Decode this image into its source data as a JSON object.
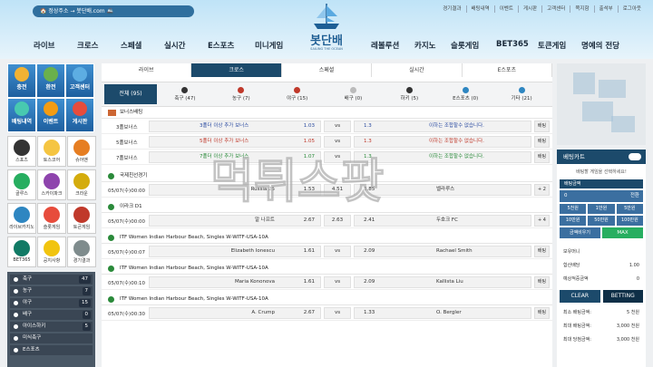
{
  "header": {
    "announce": "🏠 정상주소 → 봇단배.com 🚢",
    "top_links": [
      "경기결과",
      "배팅내역",
      "이벤트",
      "게시판",
      "고객센터",
      "쪽지함",
      "출석부",
      "로그아웃"
    ],
    "logo_name": "봇단배",
    "logo_sub": "SAILING THE OCEAN",
    "nav": [
      "라이브",
      "크로스",
      "스페셜",
      "실시간",
      "E스포츠",
      "미니게임",
      "레볼루션",
      "카지노",
      "슬롯게임",
      "BET365",
      "토큰게임",
      "명예의 전당"
    ]
  },
  "quick": [
    {
      "label": "충전",
      "color": "#f2b233"
    },
    {
      "label": "환전",
      "color": "#6ab04c"
    },
    {
      "label": "고객센터",
      "color": "#5dade2"
    },
    {
      "label": "배팅내역",
      "color": "#48c9b0"
    },
    {
      "label": "이벤트",
      "color": "#f39c12"
    },
    {
      "label": "게시판",
      "color": "#e74c3c"
    }
  ],
  "games": [
    {
      "label": "스포츠",
      "color": "#333"
    },
    {
      "label": "토스코어",
      "color": "#f5c542"
    },
    {
      "label": "슈어맨",
      "color": "#e67e22"
    },
    {
      "label": "골루스",
      "color": "#27ae60"
    },
    {
      "label": "스카이파크",
      "color": "#8e44ad"
    },
    {
      "label": "크라운",
      "color": "#d4ac0d"
    },
    {
      "label": "라이브카지노",
      "color": "#2e86c1"
    },
    {
      "label": "슬롯게임",
      "color": "#e74c3c"
    },
    {
      "label": "토큰게임",
      "color": "#c0392b"
    },
    {
      "label": "BET365",
      "color": "#117a65"
    },
    {
      "label": "공지사항",
      "color": "#f1c40f"
    },
    {
      "label": "경기결과",
      "color": "#7f8c8d"
    }
  ],
  "sports": [
    {
      "name": "축구",
      "count": "47"
    },
    {
      "name": "농구",
      "count": "7"
    },
    {
      "name": "야구",
      "count": "15"
    },
    {
      "name": "배구",
      "count": "0"
    },
    {
      "name": "아이스하키",
      "count": "5"
    },
    {
      "name": "미식축구",
      "count": ""
    },
    {
      "name": "E스포츠",
      "count": ""
    }
  ],
  "tabs": [
    "라이브",
    "크로스",
    "스페셜",
    "실시간",
    "E스포츠"
  ],
  "filters": {
    "all": "전체 (95)",
    "items": [
      "축구 (47)",
      "농구 (7)",
      "야구 (15)",
      "배구 (0)",
      "하키 (5)",
      "E스포츠 (0)",
      "기타 (21)"
    ]
  },
  "sections": [
    {
      "title": "보너스배팅",
      "rows": [
        {
          "left": "3폴보너스",
          "mid": "3폴더 이상 추가 보너스",
          "odds": "1.03",
          "vs": "vs",
          "r": "1.3",
          "right": "이하는 조합할수 없습니다.",
          "bet": "배팅",
          "cls": "blue"
        },
        {
          "left": "5폴보너스",
          "mid": "5폴더 이상 추가 보너스",
          "odds": "1.05",
          "vs": "vs",
          "r": "1.3",
          "right": "이하는 조합할수 없습니다.",
          "bet": "배팅",
          "cls": "red"
        },
        {
          "left": "7폴보너스",
          "mid": "7폴더 이상 추가 보너스",
          "odds": "1.07",
          "vs": "vs",
          "r": "1.3",
          "right": "이하는 조합할수 없습니다.",
          "bet": "배팅",
          "cls": "green"
        }
      ]
    },
    {
      "title": "국제친선경기",
      "rows": [
        {
          "time": "05/07(수)00:00",
          "home": "Russia 25",
          "h": "1.53",
          "d": "4.51",
          "a": "3.85",
          "away": "벨라루스",
          "bet": "+ 2"
        }
      ]
    },
    {
      "title": "이라크 D1",
      "rows": [
        {
          "time": "05/07(수)00:00",
          "home": "알 나프트",
          "h": "2.67",
          "d": "2.63",
          "a": "2.41",
          "away": "두호크 FC",
          "bet": "+ 4"
        }
      ]
    },
    {
      "title": "ITF Women Indian Harbour Beach, Singles W-WITF-USA-10A",
      "rows": [
        {
          "time": "05/07(수)00:07",
          "home": "Elizabeth Ionescu",
          "h": "1.61",
          "d": "vs",
          "a": "2.09",
          "away": "Rachael Smith",
          "bet": "배팅"
        }
      ]
    },
    {
      "title": "ITF Women Indian Harbour Beach, Singles W-WITF-USA-10A",
      "rows": [
        {
          "time": "05/07(수)00:10",
          "home": "Maria Kononova",
          "h": "1.61",
          "d": "vs",
          "a": "2.09",
          "away": "Kallista Liu",
          "bet": "배팅"
        }
      ]
    },
    {
      "title": "ITF Women Indian Harbour Beach, Singles W-WITF-USA-10A",
      "rows": [
        {
          "time": "05/07(수)00:30",
          "home": "A. Crump",
          "h": "2.67",
          "d": "vs",
          "a": "1.33",
          "away": "O. Bergler",
          "bet": "배팅"
        }
      ]
    }
  ],
  "betslip": {
    "title": "베팅카트",
    "msg": "배팅할 게임을 선택하세요!",
    "amount_label": "배팅금액",
    "input_val": "0",
    "input_btn": "전환",
    "chips": [
      "5천원",
      "1만원",
      "5만원",
      "10만원",
      "50만원",
      "100만원"
    ],
    "reset": "금액비우기",
    "max": "MAX",
    "info": [
      [
        "보유머니",
        ""
      ],
      [
        "합산배당",
        "1.00"
      ],
      [
        "예상적중금액",
        "0"
      ]
    ],
    "clear": "CLEAR",
    "betting": "BETTING",
    "limits": [
      [
        "최소 배팅금액:",
        "5 천원"
      ],
      [
        "최대 배팅금액:",
        "3,000 천원"
      ],
      [
        "최대 당첨금액:",
        "3,000 천원"
      ]
    ]
  },
  "watermark": "먹튀스팟"
}
